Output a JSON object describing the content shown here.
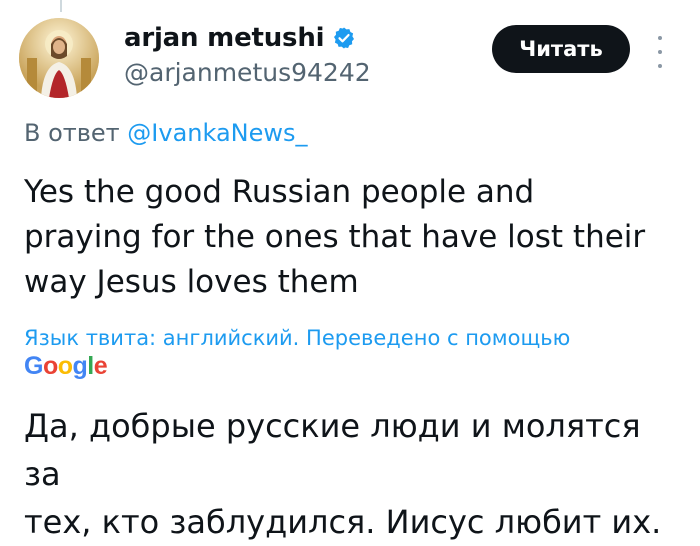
{
  "author": {
    "display_name": "arjan metushi",
    "handle": "@arjanmetus94242",
    "verified": true,
    "avatar_icon": "avatar-photo"
  },
  "actions": {
    "follow_label": "Читать",
    "more_icon": "more-vertical-icon"
  },
  "reply": {
    "prefix": "В ответ ",
    "target": "@IvankaNews_"
  },
  "tweet": {
    "text_line1": "Yes the good Russian people and",
    "text_line2": "praying for the ones that have lost their",
    "text_line3": "way Jesus loves them"
  },
  "translation": {
    "note": "Язык твита: английский. Переведено с помощью",
    "provider": "Google",
    "line1": "Да, добрые русские люди и молятся за",
    "line2": "тех, кто заблудился. Иисус любит их."
  },
  "colors": {
    "link": "#1d9bf0",
    "muted": "#536471",
    "button_bg": "#0f1419",
    "verified": "#1d9bf0"
  }
}
